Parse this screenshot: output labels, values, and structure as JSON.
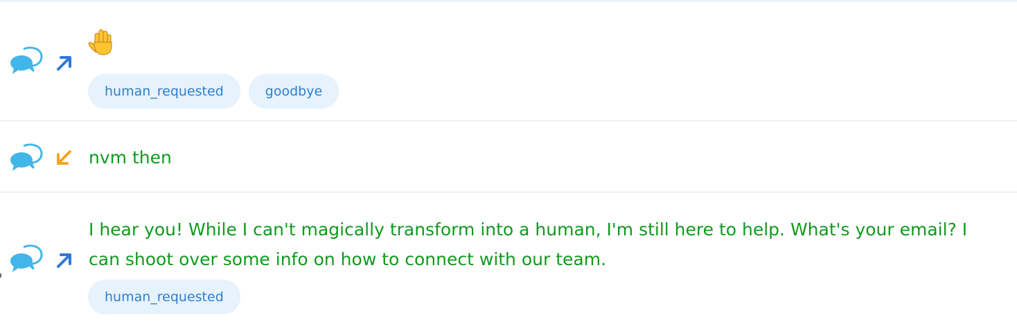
{
  "rows": [
    {
      "emoji": "raised-hand-icon",
      "tags": [
        "human_requested",
        "goodbye"
      ]
    },
    {
      "text": "nvm then"
    },
    {
      "text": "I hear you! While I can't magically transform into a human, I'm still here to help. What's your email? I can shoot over some info on how to connect with our team.",
      "tags": [
        "human_requested"
      ]
    }
  ],
  "colors": {
    "message_text": "#119a1e",
    "tag_bg": "#e6f2fc",
    "tag_text": "#2e7fd0",
    "outgoing_arrow": "#2f78d8",
    "incoming_arrow": "#f5a623",
    "chat_icon": "#42b6e8",
    "divider": "#dbe6f1"
  }
}
